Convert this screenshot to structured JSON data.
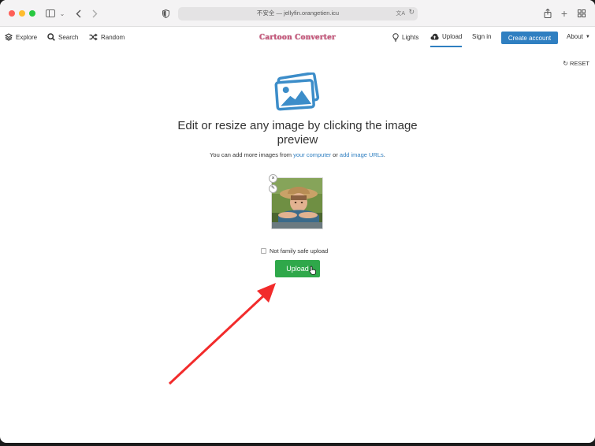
{
  "browser": {
    "url_text": "不安全 — jellyfin.orangetien.icu",
    "translate_glyph": "文A"
  },
  "nav": {
    "explore": "Explore",
    "search": "Search",
    "random": "Random",
    "logo": "Cartoon Converter",
    "lights": "Lights",
    "upload": "Upload",
    "sign_in": "Sign in",
    "create_account": "Create account",
    "about": "About"
  },
  "reset_label": "RESET",
  "main": {
    "headline_line1": "Edit or resize any image by clicking the image",
    "headline_line2": "preview",
    "sub_prefix": "You can add more images from ",
    "sub_link1": "your computer",
    "sub_mid": " or ",
    "sub_link2": "add image URLs",
    "sub_suffix": ".",
    "checkbox_label": "Not family safe upload",
    "upload_button": "Upload"
  },
  "colors": {
    "accent_blue": "#2f7fc1",
    "upload_green": "#2fa84a",
    "arrow_red": "#f22b2b"
  }
}
